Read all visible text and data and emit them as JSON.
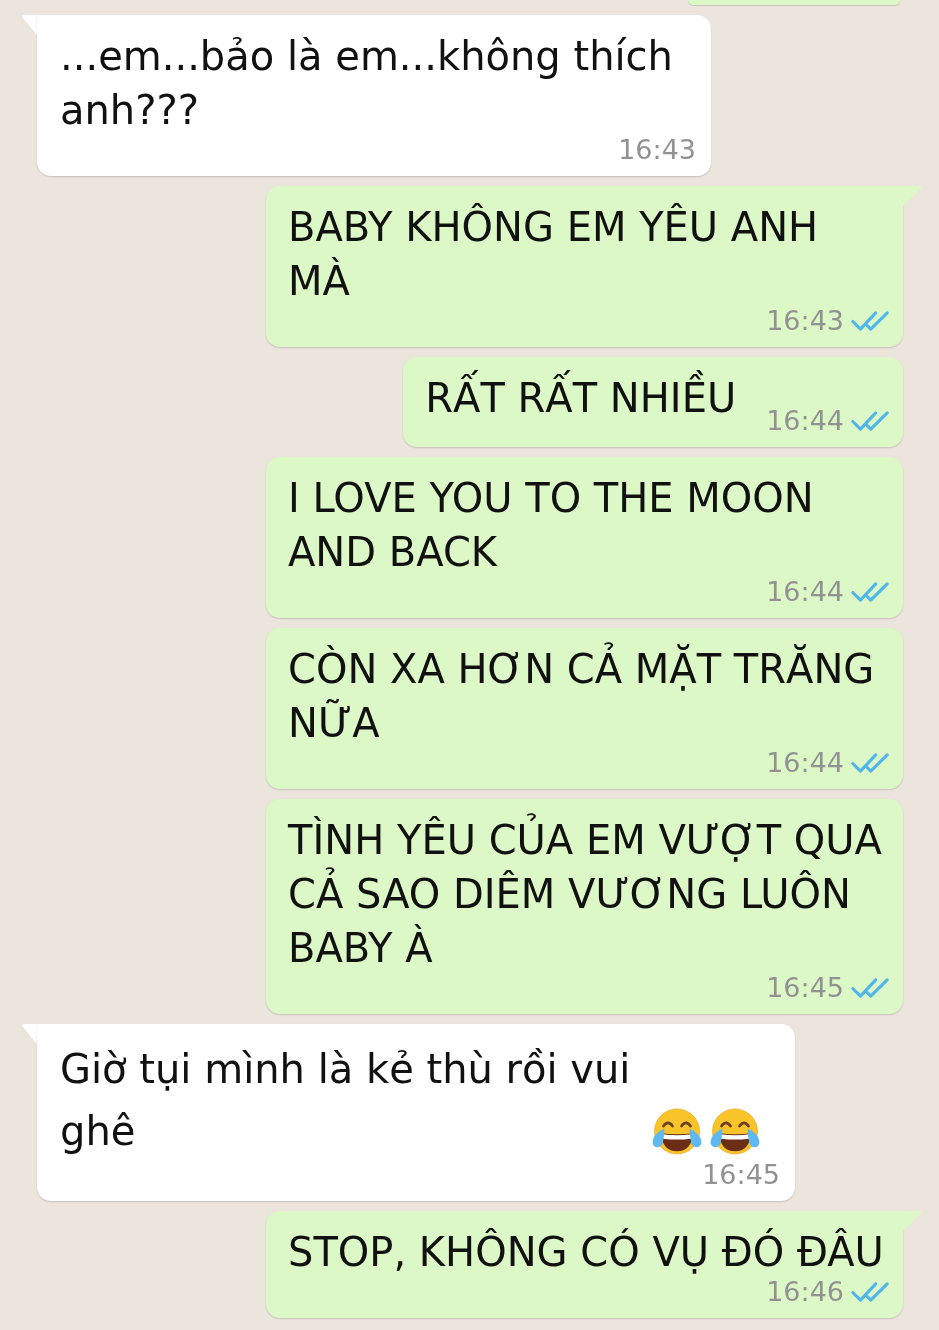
{
  "messages": [
    {
      "kind": "outgoing",
      "cut_off": true
    },
    {
      "kind": "incoming",
      "cut_off": false,
      "text": "...em...bảo là em...không thích anh???",
      "time": "16:43"
    },
    {
      "kind": "outgoing",
      "cut_off": false,
      "text": "BABY KHÔNG EM YÊU ANH MÀ",
      "time": "16:43",
      "read": true
    },
    {
      "kind": "outgoing",
      "cut_off": false,
      "text": "RẤT RẤT NHIỀU",
      "time": "16:44",
      "read": true
    },
    {
      "kind": "outgoing",
      "cut_off": false,
      "text": "I LOVE YOU TO THE MOON AND BACK",
      "time": "16:44",
      "read": true
    },
    {
      "kind": "outgoing",
      "cut_off": false,
      "text": "CÒN XA HƠN CẢ MẶT TRĂNG NỮA",
      "time": "16:44",
      "read": true
    },
    {
      "kind": "outgoing",
      "cut_off": false,
      "text": "TÌNH YÊU CỦA EM VƯỢT QUA CẢ SAO DIÊM VƯƠNG LUÔN BABY À",
      "time": "16:45",
      "read": true
    },
    {
      "kind": "incoming",
      "cut_off": false,
      "text": "Giờ tụi mình là kẻ thù rồi vui ghê",
      "emojis": [
        {
          "kind": "tears_of_joy"
        },
        {
          "kind": "tears_of_joy"
        }
      ],
      "time": "16:45"
    },
    {
      "kind": "outgoing",
      "cut_off": false,
      "text": "STOP, KHÔNG CÓ VỤ ĐÓ ĐÂU",
      "time": "16:46",
      "read": true
    }
  ]
}
